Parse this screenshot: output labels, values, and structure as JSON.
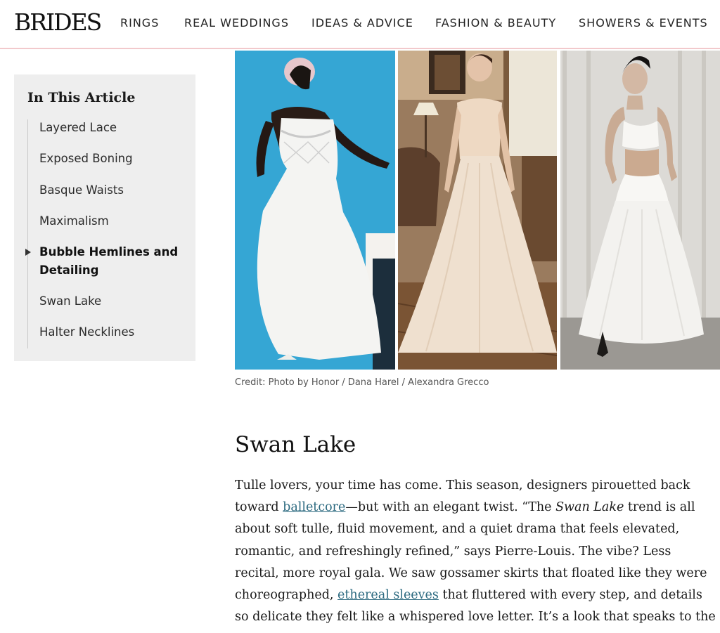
{
  "header": {
    "logo": "BRIDES",
    "nav": [
      "RINGS",
      "REAL WEDDINGS",
      "IDEAS & ADVICE",
      "FASHION & BEAUTY",
      "SHOWERS & EVENTS"
    ]
  },
  "toc": {
    "title": "In This Article",
    "items": [
      {
        "label": "Layered Lace"
      },
      {
        "label": "Exposed Boning"
      },
      {
        "label": "Basque Waists"
      },
      {
        "label": "Maximalism"
      },
      {
        "label_line1": "Bubble Hemlines and",
        "label_line2": "Detailing",
        "active": true
      },
      {
        "label": "Swan Lake"
      },
      {
        "label": "Halter Necklines"
      }
    ]
  },
  "photos": {
    "credit": "Credit: Photo by Honor / Dana Harel / Alexandra Grecco"
  },
  "article": {
    "heading": "Swan Lake",
    "lines": [
      {
        "text": "Tulle lovers, your time has come. This season, designers pirouetted back"
      },
      {
        "before": "toward ",
        "link": "balletcore",
        "after": "—but with an elegant twist. “The ",
        "italic": "Swan Lake",
        "after2": " trend is all"
      },
      {
        "text": "about soft tulle, fluid movement, and a quiet drama that feels elevated,"
      },
      {
        "text": "romantic, and refreshingly refined,” says Pierre-Louis. The vibe? Less"
      },
      {
        "text": "recital, more royal gala. We saw gossamer skirts that floated like they were"
      },
      {
        "before": "choreographed, ",
        "link": "ethereal sleeves",
        "after": " that fluttered with every step, and details"
      },
      {
        "text": "so delicate they felt like a whispered love letter. It’s a look that speaks to the"
      }
    ]
  },
  "colors": {
    "header_border": "#f2c9cc",
    "toc_background": "#eeeeee",
    "link": "#2c6a80",
    "photo1_background": "#35a6d4"
  }
}
